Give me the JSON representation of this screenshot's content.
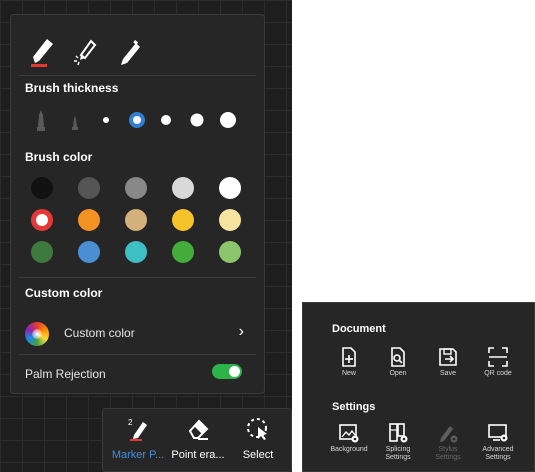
{
  "brush_panel": {
    "pen_tabs": [
      {
        "icon": "marker-pen-icon",
        "selected": true
      },
      {
        "icon": "highlighter-pen-icon",
        "selected": false
      },
      {
        "icon": "pencil-icon",
        "selected": false
      }
    ],
    "thickness_title": "Brush thickness",
    "thickness_options": [
      {
        "icon": "brush-tip-icon",
        "kind": "tip-large"
      },
      {
        "icon": "brush-tip-icon",
        "kind": "tip-small"
      },
      {
        "kind": "dot",
        "level": 1
      },
      {
        "kind": "dot",
        "level": 2,
        "selected": true
      },
      {
        "kind": "dot",
        "level": 3
      },
      {
        "kind": "dot",
        "level": 4
      },
      {
        "kind": "dot",
        "level": 5
      }
    ],
    "color_title": "Brush color",
    "colors": [
      [
        "#111111",
        "#555555",
        "#888888",
        "#d9d9d9",
        "#ffffff"
      ],
      [
        "#e53935",
        "#f39223",
        "#d3b07c",
        "#f6c32a",
        "#f5e3a0"
      ],
      [
        "#3f7a3d",
        "#4a8fd4",
        "#3dbfc4",
        "#43ac3a",
        "#8bc66c"
      ]
    ],
    "selected_color": "#e53935",
    "custom_title": "Custom color",
    "custom_label": "Custom color",
    "palm_rejection_label": "Palm Rejection",
    "palm_rejection_on": true,
    "accent": "#2f80d1",
    "toggle_color": "#2db34a"
  },
  "toolbar": {
    "marker_label": "Marker P...",
    "marker_badge": "2",
    "eraser_label": "Point era...",
    "select_label": "Select",
    "active_color": "#3d8fe0"
  },
  "doc_panel": {
    "document_title": "Document",
    "document_items": [
      {
        "label": "New",
        "icon": "new-file-icon"
      },
      {
        "label": "Open",
        "icon": "open-file-icon"
      },
      {
        "label": "Save",
        "icon": "save-icon"
      },
      {
        "label": "QR code",
        "icon": "qr-scan-icon"
      }
    ],
    "settings_title": "Settings",
    "settings_items": [
      {
        "label": "Background",
        "icon": "background-settings-icon",
        "enabled": true
      },
      {
        "label": "Splicing\nSettings",
        "icon": "splicing-settings-icon",
        "enabled": true
      },
      {
        "label": "Stylus\nSettings",
        "icon": "stylus-settings-icon",
        "enabled": false
      },
      {
        "label": "Advanced\nSettings",
        "icon": "advanced-settings-icon",
        "enabled": true
      }
    ]
  }
}
